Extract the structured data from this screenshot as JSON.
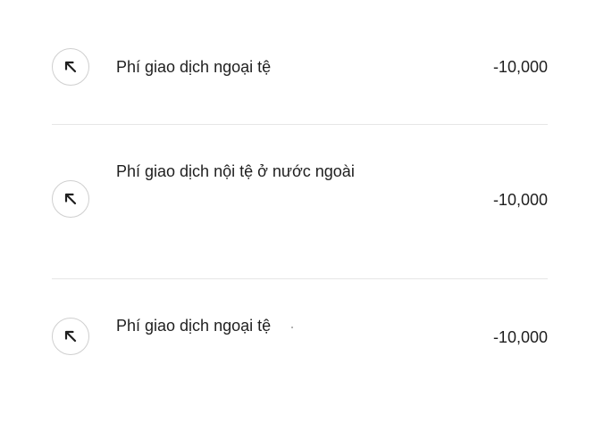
{
  "transactions": [
    {
      "label": "Phí giao dịch ngoại tệ",
      "amount": "-10,000",
      "icon": "arrow-up-left-icon"
    },
    {
      "label": "Phí giao dịch nội tệ ở nước ngoài",
      "amount": "-10,000",
      "icon": "arrow-up-left-icon"
    },
    {
      "label": "Phí giao dịch ngoại tệ",
      "amount": "-10,000",
      "icon": "arrow-up-left-icon"
    }
  ],
  "colors": {
    "text": "#1f1f1f",
    "divider": "#e6e6e6",
    "icon_border": "#cfcfcf",
    "background": "#ffffff"
  }
}
